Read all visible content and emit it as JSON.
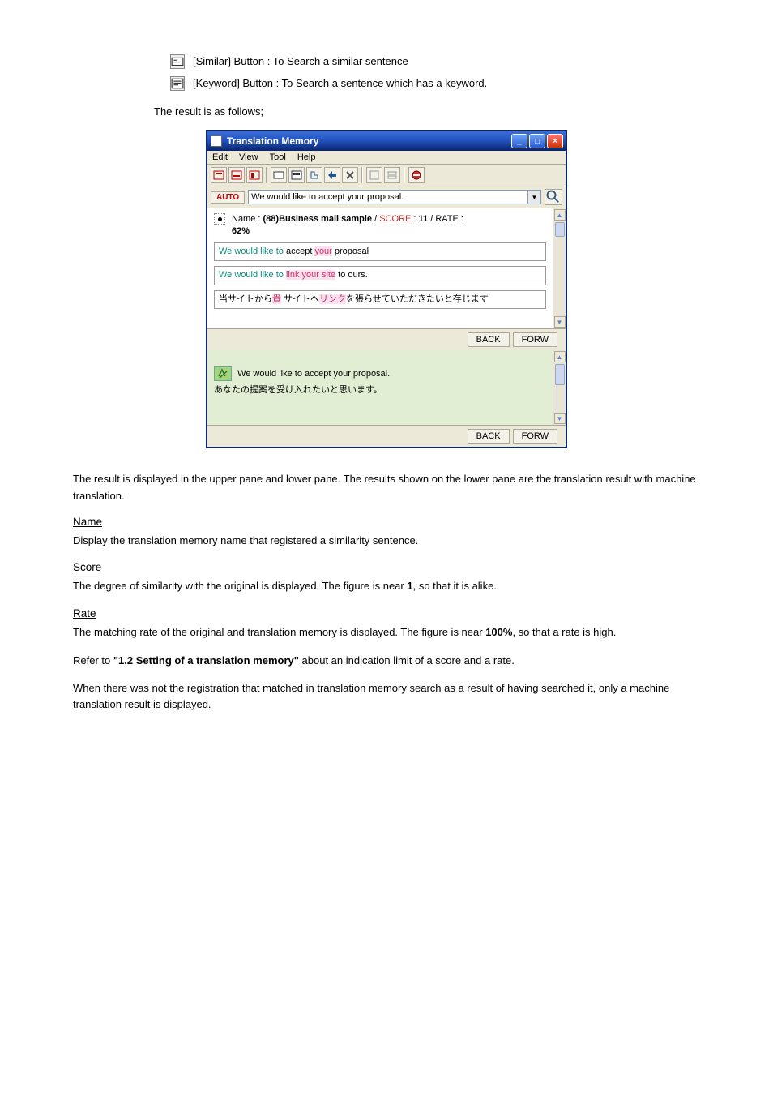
{
  "intro": {
    "line1": "[Similar] Button",
    "line1_rest": " : To Search a similar sentence",
    "line2": "[Keyword] Button",
    "line2_rest": " : To Search a sentence which has a keyword.",
    "footer": "The result is as follows;"
  },
  "window": {
    "title": "Translation Memory",
    "menu": [
      "Edit",
      "View",
      "Tool",
      "Help"
    ],
    "auto_label": "AUTO",
    "search_value": "We would like to accept your proposal.",
    "back": "BACK",
    "forw": "FORW"
  },
  "result": {
    "meta_name_label": "Name : ",
    "meta_name": "(88)Business mail sample",
    "meta_sep": " / ",
    "meta_score_label": "SCORE : ",
    "meta_score": "11",
    "meta_rate_label": "RATE : ",
    "meta_rate": "62%",
    "seg1_a": "We ",
    "seg1_b": "would like to",
    "seg1_c": " accept ",
    "seg1_d": "your",
    "seg1_e": " proposal",
    "seg2_a": "We ",
    "seg2_b": "would like to ",
    "seg2_c": "link ",
    "seg2_d": "your ",
    "seg2_e": "site",
    "seg2_f": " to ours.",
    "seg3_a": "当サイトから",
    "seg3_b": "貴",
    "seg3_c": " サイトへ",
    "seg3_d": "リンク",
    "seg3_e": "を張らせていただきたいと存じます",
    "mt_src": "We would like to accept your proposal.",
    "mt_tgt": "あなたの提案を受け入れたいと思います。"
  },
  "explain": {
    "p1": "The result is displayed in the upper pane and lower pane. The results shown on the lower pane are the translation result with machine translation.",
    "term1_t": "Name",
    "term1_d": "Display the translation memory name that registered a similarity sentence.",
    "term2_t": "Score",
    "term2_d_a": "The degree of similarity with the original is displayed. The figure is near ",
    "term2_d_b": "1",
    "term2_d_c": ", so that it is alike.",
    "term3_t": "Rate",
    "term3_d_a": "The matching rate of the original and translation memory is displayed. The figure is near ",
    "term3_d_b": "100%",
    "term3_d_c": ", so that a rate is high.",
    "p_seg_a": "Refer to ",
    "p_seg_b": "\"1.2 Setting of a translation memory\"",
    "p_seg_c": " about an indication limit of a score and a rate.",
    "p_last": "When there was not the registration that matched in translation memory search as a result of having searched it, only a machine translation result is displayed."
  }
}
